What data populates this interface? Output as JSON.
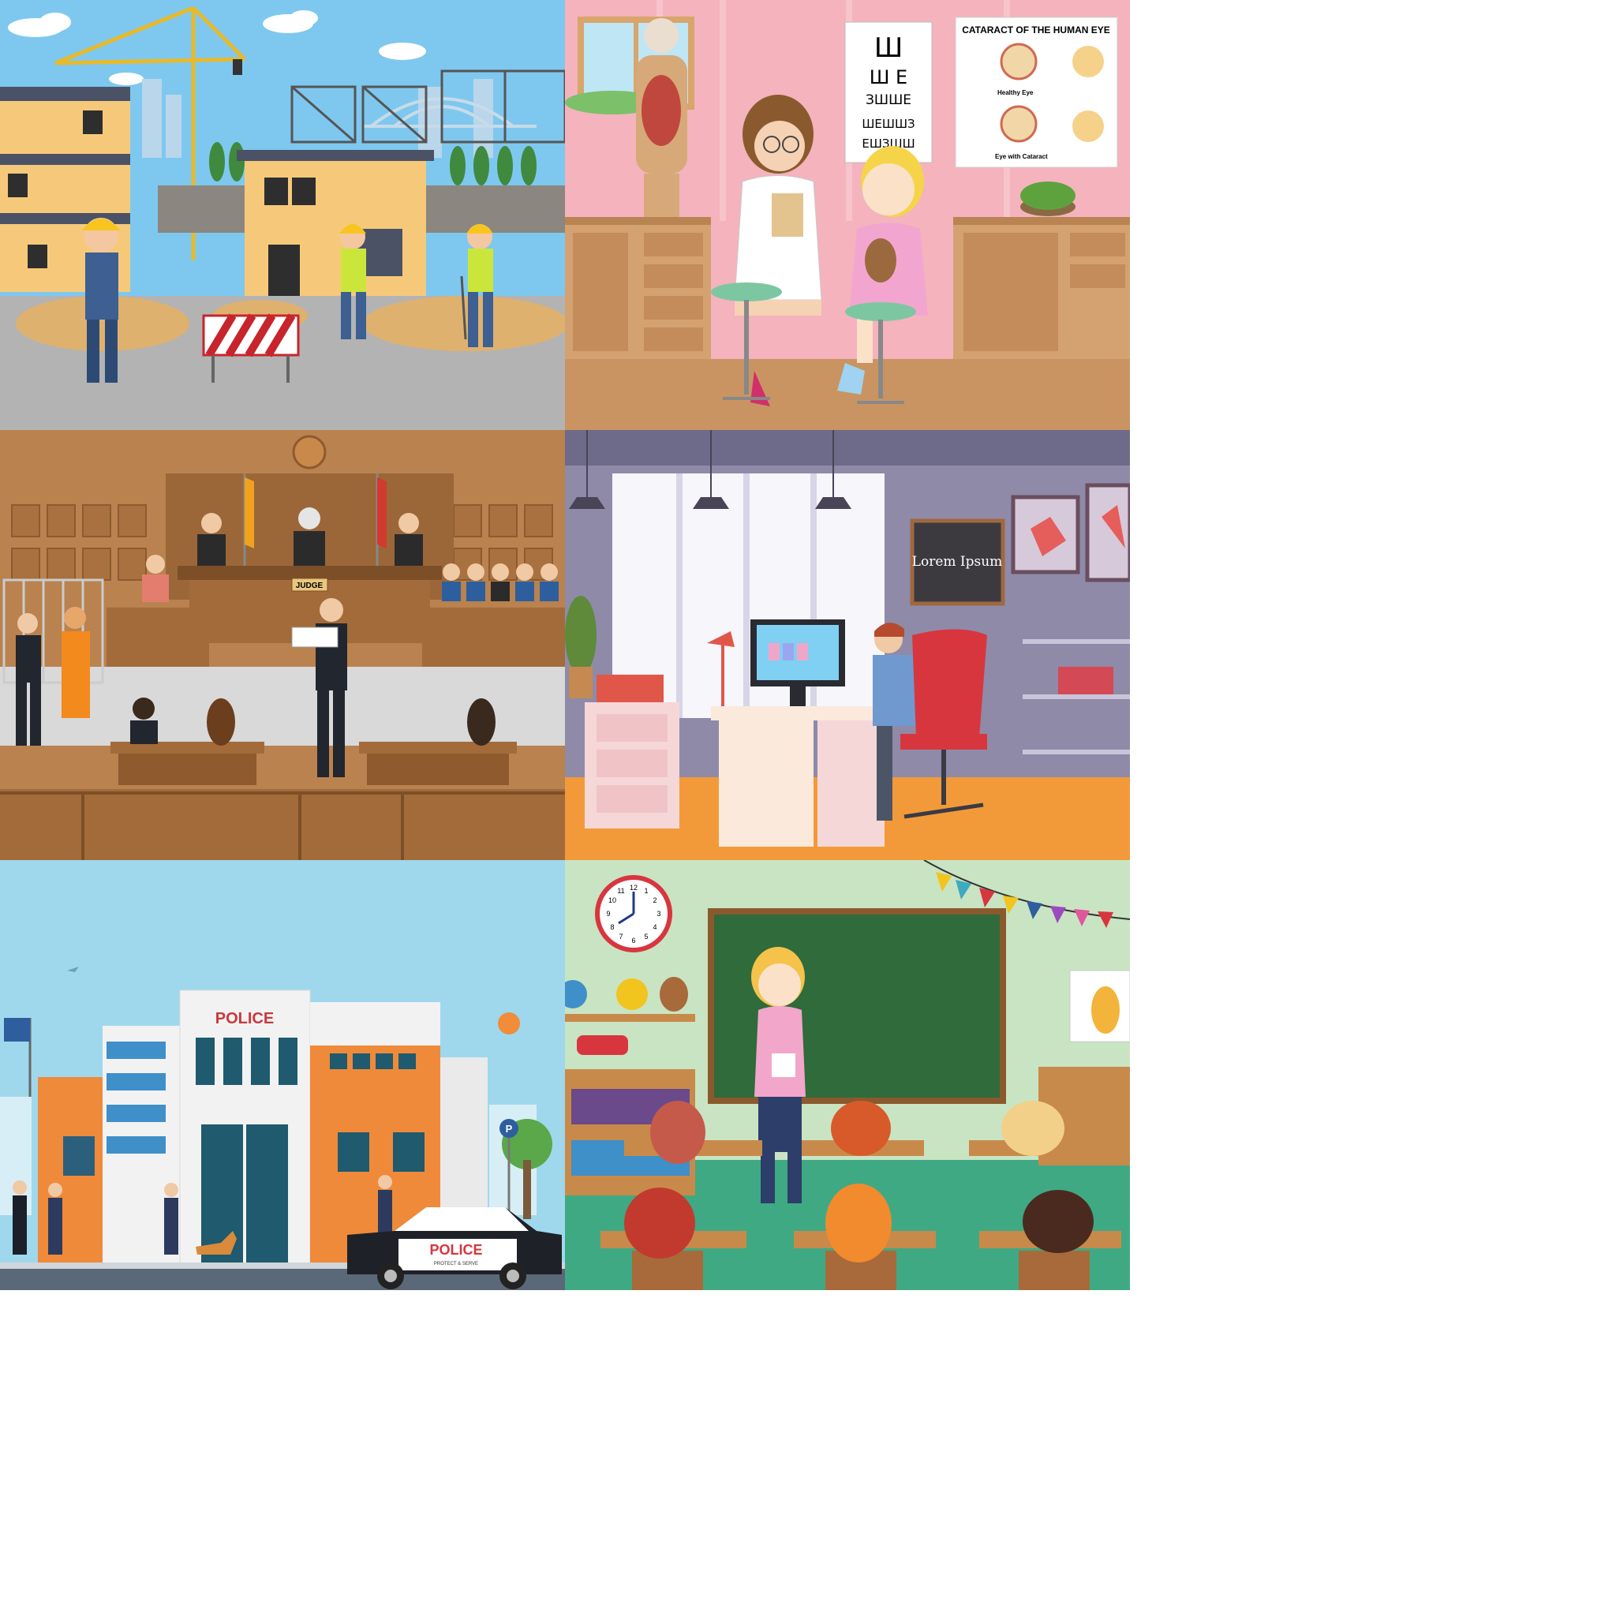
{
  "panels": {
    "construction": {},
    "clinic": {
      "eye_chart": {
        "row1": "Ш",
        "row2": "Ш Е",
        "row3": "ЗШШЕ",
        "row4": "ШЕШШЗ",
        "row5": "ЕШЗШШ"
      },
      "poster": {
        "title": "CATARACT OF THE HUMAN EYE",
        "caption_healthy": "Healthy Eye",
        "caption_cataract": "Eye with Cataract"
      }
    },
    "courtroom": {
      "bench_plate": "JUDGE"
    },
    "office": {
      "chalkboard": "Lorem Ipsum"
    },
    "police": {
      "building_sign": "POLICE",
      "car_label": "POLICE",
      "car_tagline": "PROTECT & SERVE",
      "parking_sign": "P"
    },
    "classroom": {
      "clock_numbers": [
        "12",
        "1",
        "2",
        "3",
        "4",
        "5",
        "6",
        "7",
        "8",
        "9",
        "10",
        "11"
      ]
    }
  },
  "colors": {
    "sky": "#7ec8ef",
    "clinic_wall": "#f4b3bd",
    "court_wood": "#b9824f",
    "office_wall": "#8f8aa8",
    "police_sky": "#9fd8ec",
    "classroom_wall": "#c9e4c2",
    "chalkboard": "#2f6b3b"
  }
}
